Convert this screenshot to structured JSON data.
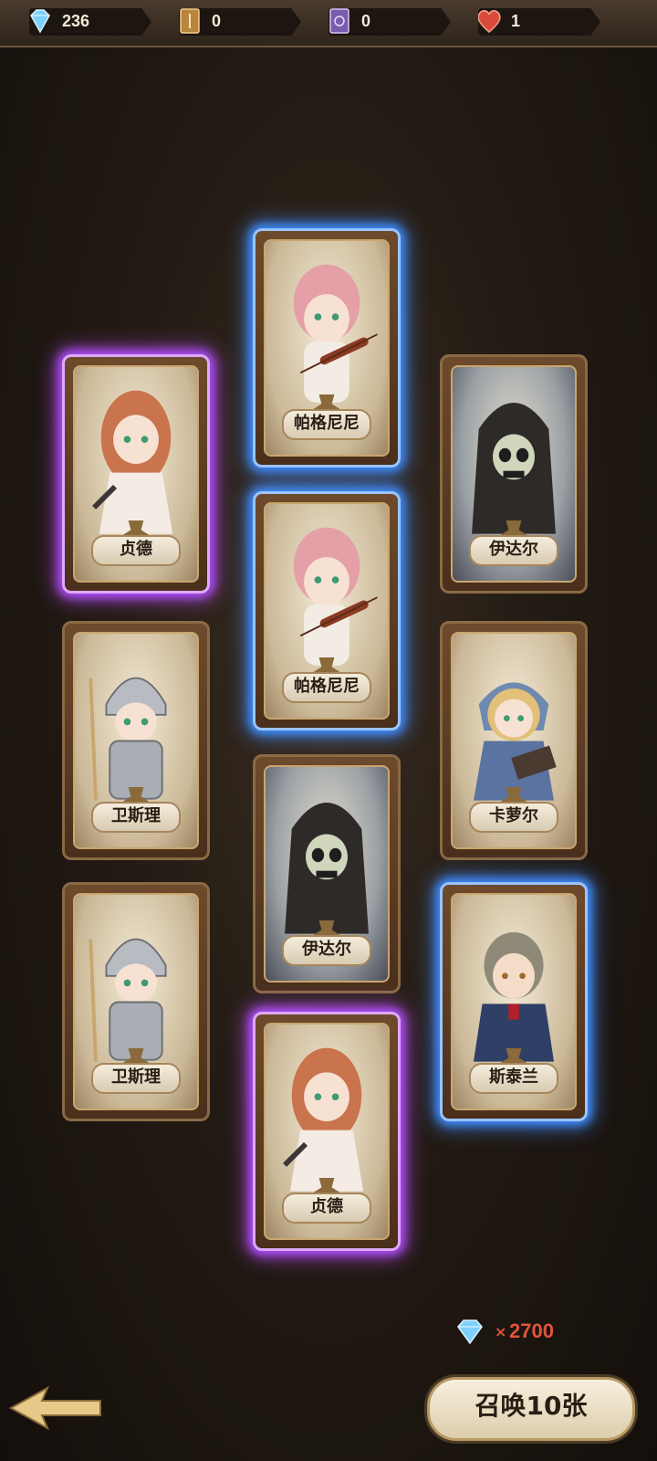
{
  "resources": [
    {
      "name": "diamond",
      "value": "236",
      "icon": "diamond-icon"
    },
    {
      "name": "gold-book",
      "value": "0",
      "icon": "gold-book-icon"
    },
    {
      "name": "purple-book",
      "value": "0",
      "icon": "purple-book-icon"
    },
    {
      "name": "heart",
      "value": "1",
      "icon": "heart-icon"
    }
  ],
  "cards": [
    {
      "name": "帕格尼尼",
      "glow": "blue",
      "art": "violinist"
    },
    {
      "name": "贞德",
      "glow": "purple",
      "art": "maiden"
    },
    {
      "name": "伊达尔",
      "glow": "none",
      "art": "reaper"
    },
    {
      "name": "帕格尼尼",
      "glow": "blue",
      "art": "violinist"
    },
    {
      "name": "卫斯理",
      "glow": "none",
      "art": "knight"
    },
    {
      "name": "卡萝尔",
      "glow": "none",
      "art": "nun"
    },
    {
      "name": "伊达尔",
      "glow": "none",
      "art": "reaper"
    },
    {
      "name": "卫斯理",
      "glow": "none",
      "art": "knight"
    },
    {
      "name": "斯泰兰",
      "glow": "blue",
      "art": "gentleman"
    },
    {
      "name": "贞德",
      "glow": "purple",
      "art": "maiden"
    }
  ],
  "summon": {
    "cost_prefix": "×",
    "cost": "2700",
    "button_label": "召唤10张"
  },
  "colors": {
    "rare_glow": "#3d8dff",
    "epic_glow": "#b04dff",
    "cost_text": "#e2543c"
  }
}
